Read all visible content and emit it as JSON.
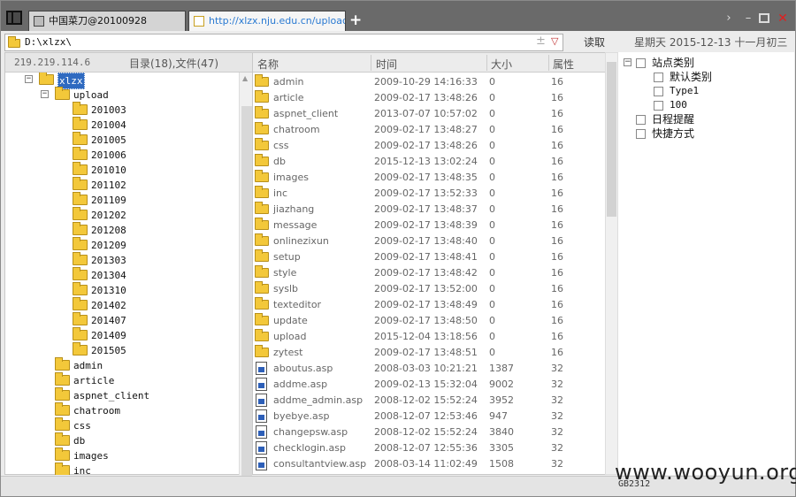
{
  "tabs": [
    {
      "label": "中国菜刀@20100928",
      "active": false
    },
    {
      "label": "http://xlzx.nju.edu.cn/upload...",
      "active": true
    }
  ],
  "new_tab": "+",
  "window_controls": {
    "forward": "›",
    "minimize": "–",
    "close": "✕"
  },
  "address": {
    "path": "D:\\xlzx\\",
    "plus": "±",
    "dropdown": "▽"
  },
  "read_button": "读取",
  "date_text": "星期天 2015-12-13 十一月初三",
  "left_header": {
    "ip": "219.219.114.6",
    "counts": "目录(18),文件(47)"
  },
  "tree": [
    {
      "label": "xlzx",
      "level": 0,
      "expander": "−",
      "selected": true
    },
    {
      "label": "upload",
      "level": 1,
      "expander": "−"
    },
    {
      "label": "201003",
      "level": 2
    },
    {
      "label": "201004",
      "level": 2
    },
    {
      "label": "201005",
      "level": 2
    },
    {
      "label": "201006",
      "level": 2
    },
    {
      "label": "201010",
      "level": 2
    },
    {
      "label": "201102",
      "level": 2
    },
    {
      "label": "201109",
      "level": 2
    },
    {
      "label": "201202",
      "level": 2
    },
    {
      "label": "201208",
      "level": 2
    },
    {
      "label": "201209",
      "level": 2
    },
    {
      "label": "201303",
      "level": 2
    },
    {
      "label": "201304",
      "level": 2
    },
    {
      "label": "201310",
      "level": 2
    },
    {
      "label": "201402",
      "level": 2
    },
    {
      "label": "201407",
      "level": 2
    },
    {
      "label": "201409",
      "level": 2
    },
    {
      "label": "201505",
      "level": 2
    },
    {
      "label": "admin",
      "level": 1
    },
    {
      "label": "article",
      "level": 1
    },
    {
      "label": "aspnet_client",
      "level": 1
    },
    {
      "label": "chatroom",
      "level": 1
    },
    {
      "label": "css",
      "level": 1
    },
    {
      "label": "db",
      "level": 1
    },
    {
      "label": "images",
      "level": 1
    },
    {
      "label": "inc",
      "level": 1
    }
  ],
  "columns": {
    "name": "名称",
    "time": "时间",
    "size": "大小",
    "attr": "属性"
  },
  "files": [
    {
      "type": "folder",
      "name": "admin",
      "time": "2009-10-29 14:16:33",
      "size": "0",
      "attr": "16"
    },
    {
      "type": "folder",
      "name": "article",
      "time": "2009-02-17 13:48:26",
      "size": "0",
      "attr": "16"
    },
    {
      "type": "folder",
      "name": "aspnet_client",
      "time": "2013-07-07 10:57:02",
      "size": "0",
      "attr": "16"
    },
    {
      "type": "folder",
      "name": "chatroom",
      "time": "2009-02-17 13:48:27",
      "size": "0",
      "attr": "16"
    },
    {
      "type": "folder",
      "name": "css",
      "time": "2009-02-17 13:48:26",
      "size": "0",
      "attr": "16"
    },
    {
      "type": "folder",
      "name": "db",
      "time": "2015-12-13 13:02:24",
      "size": "0",
      "attr": "16"
    },
    {
      "type": "folder",
      "name": "images",
      "time": "2009-02-17 13:48:35",
      "size": "0",
      "attr": "16"
    },
    {
      "type": "folder",
      "name": "inc",
      "time": "2009-02-17 13:52:33",
      "size": "0",
      "attr": "16"
    },
    {
      "type": "folder",
      "name": "jiazhang",
      "time": "2009-02-17 13:48:37",
      "size": "0",
      "attr": "16"
    },
    {
      "type": "folder",
      "name": "message",
      "time": "2009-02-17 13:48:39",
      "size": "0",
      "attr": "16"
    },
    {
      "type": "folder",
      "name": "onlinezixun",
      "time": "2009-02-17 13:48:40",
      "size": "0",
      "attr": "16"
    },
    {
      "type": "folder",
      "name": "setup",
      "time": "2009-02-17 13:48:41",
      "size": "0",
      "attr": "16"
    },
    {
      "type": "folder",
      "name": "style",
      "time": "2009-02-17 13:48:42",
      "size": "0",
      "attr": "16"
    },
    {
      "type": "folder",
      "name": "syslb",
      "time": "2009-02-17 13:52:00",
      "size": "0",
      "attr": "16"
    },
    {
      "type": "folder",
      "name": "texteditor",
      "time": "2009-02-17 13:48:49",
      "size": "0",
      "attr": "16"
    },
    {
      "type": "folder",
      "name": "update",
      "time": "2009-02-17 13:48:50",
      "size": "0",
      "attr": "16"
    },
    {
      "type": "folder",
      "name": "upload",
      "time": "2015-12-04 13:18:56",
      "size": "0",
      "attr": "16"
    },
    {
      "type": "folder",
      "name": "zytest",
      "time": "2009-02-17 13:48:51",
      "size": "0",
      "attr": "16"
    },
    {
      "type": "file",
      "name": "aboutus.asp",
      "time": "2008-03-03 10:21:21",
      "size": "1387",
      "attr": "32"
    },
    {
      "type": "file",
      "name": "addme.asp",
      "time": "2009-02-13 15:32:04",
      "size": "9002",
      "attr": "32"
    },
    {
      "type": "file",
      "name": "addme_admin.asp",
      "time": "2008-12-02 15:52:24",
      "size": "3952",
      "attr": "32"
    },
    {
      "type": "file",
      "name": "byebye.asp",
      "time": "2008-12-07 12:53:46",
      "size": "947",
      "attr": "32"
    },
    {
      "type": "file",
      "name": "changepsw.asp",
      "time": "2008-12-02 15:52:24",
      "size": "3840",
      "attr": "32"
    },
    {
      "type": "file",
      "name": "checklogin.asp",
      "time": "2008-12-07 12:55:36",
      "size": "3305",
      "attr": "32"
    },
    {
      "type": "file",
      "name": "consultantview.asp",
      "time": "2008-03-14 11:02:49",
      "size": "1508",
      "attr": "32"
    }
  ],
  "right_tree": [
    {
      "label": "站点类别",
      "level": 0,
      "expander": "−",
      "icon": "site-category-icon"
    },
    {
      "label": "默认类别",
      "level": 1,
      "icon": "page-icon"
    },
    {
      "label": "Type1",
      "level": 1,
      "icon": "page-icon",
      "mono": true
    },
    {
      "label": "100",
      "level": 1,
      "icon": "page-icon",
      "mono": true
    },
    {
      "label": "日程提醒",
      "level": 0,
      "icon": "schedule-icon"
    },
    {
      "label": "快捷方式",
      "level": 0,
      "icon": "shortcut-icon"
    }
  ],
  "status": {
    "encoding": "GB2312"
  },
  "watermark": "www.wooyun.org"
}
